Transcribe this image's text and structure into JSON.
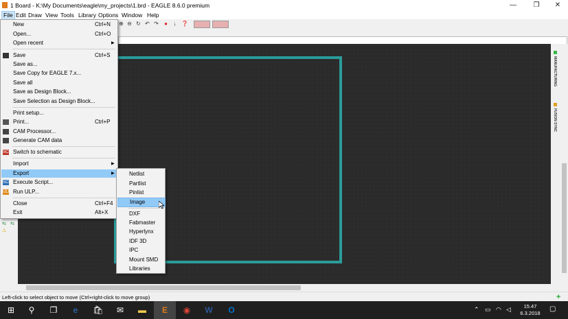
{
  "window": {
    "title": "1 Board - K:\\My Documents\\eagle\\my_projects\\1.brd - EAGLE 8.6.0 premium",
    "minimize_glyph": "—",
    "maximize_glyph": "❐",
    "close_glyph": "✕"
  },
  "menubar": [
    "File",
    "Edit",
    "Draw",
    "View",
    "Tools",
    "Library",
    "Options",
    "Window",
    "Help"
  ],
  "file_menu": [
    {
      "label": "New",
      "shortcut": "Ctrl+N"
    },
    {
      "label": "Open...",
      "shortcut": "Ctrl+O"
    },
    {
      "label": "Open recent",
      "submenu": true
    },
    {
      "label": "Save",
      "shortcut": "Ctrl+S",
      "icon": "save-icon"
    },
    {
      "label": "Save as..."
    },
    {
      "label": "Save Copy for EAGLE 7.x..."
    },
    {
      "label": "Save all"
    },
    {
      "label": "Save as Design Block..."
    },
    {
      "label": "Save Selection as Design Block..."
    },
    {
      "label": "Print setup..."
    },
    {
      "label": "Print...",
      "shortcut": "Ctrl+P",
      "icon": "printer-icon"
    },
    {
      "label": "CAM Processor...",
      "icon": "cam-icon"
    },
    {
      "label": "Generate CAM data",
      "icon": "cam-data-icon"
    },
    {
      "label": "Switch to schematic",
      "icon": "schematic-icon",
      "icon_text": "SCH"
    },
    {
      "label": "Import",
      "submenu": true
    },
    {
      "label": "Export",
      "submenu": true,
      "highlighted": true
    },
    {
      "label": "Execute Script...",
      "icon": "script-icon",
      "icon_text": "SCR"
    },
    {
      "label": "Run ULP...",
      "icon": "ulp-icon",
      "icon_text": "ULP"
    },
    {
      "label": "Close",
      "shortcut": "Ctrl+F4"
    },
    {
      "label": "Exit",
      "shortcut": "Alt+X"
    }
  ],
  "export_submenu": [
    "Netlist",
    "Partlist",
    "Pinlist",
    "Image",
    "DXF",
    "Fabmaster",
    "Hyperlynx",
    "IDF 3D",
    "IPC",
    "Mount SMD",
    "Libraries"
  ],
  "export_highlighted": "Image",
  "side_panel": {
    "manufacturing": "MANUFACTURING",
    "fusion_sync": "FUSION SYNC"
  },
  "status": "Left-click to select object to move (Ctrl+right-click to move group)",
  "clock": {
    "time": "15.47",
    "date": "6.3.2018"
  },
  "colors": {
    "board_outline": "#2a9c9a",
    "canvas": "#2b2b2b",
    "highlight": "#91c9f7"
  }
}
